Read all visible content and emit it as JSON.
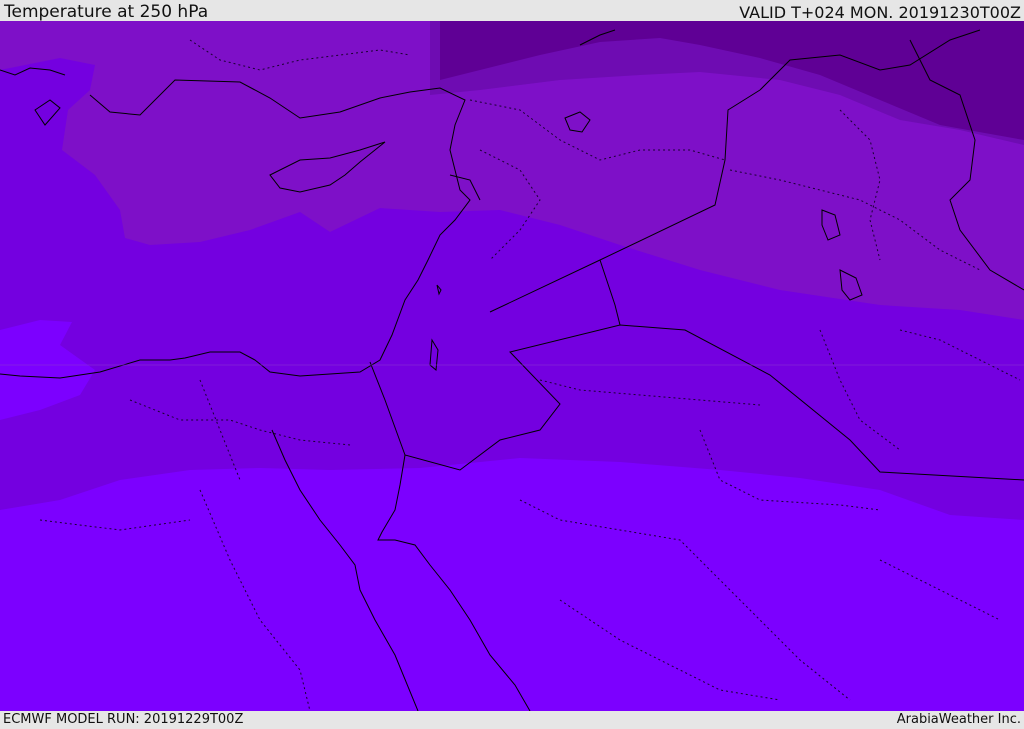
{
  "header": {
    "title": "Temperature at 250 hPa",
    "valid": "VALID T+024 MON. 20191230T00Z"
  },
  "footer": {
    "model_run": "ECMWF MODEL RUN: 20191229T00Z",
    "credit": "ArabiaWeather Inc."
  },
  "map": {
    "field": "temperature",
    "level": "250 hPa",
    "colors": {
      "darkest": "#5f0095",
      "dark": "#6e0cb2",
      "medium": "#7e10c8",
      "base": "#7400e0",
      "bright": "#7c00ff",
      "coast": "#000000"
    }
  }
}
